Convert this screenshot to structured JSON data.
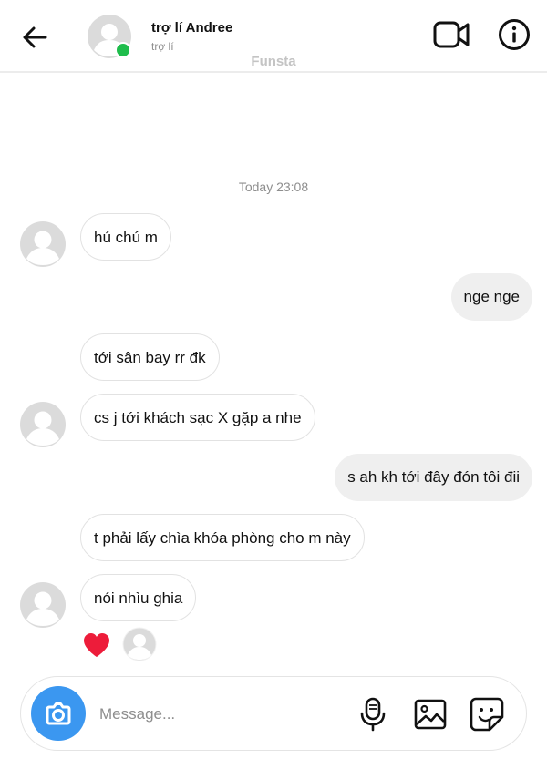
{
  "header": {
    "contact_name": "trợ lí Andree",
    "contact_subtitle": "trợ lí",
    "watermark": "Funsta"
  },
  "conversation": {
    "timestamp": "Today 23:08",
    "messages": [
      {
        "direction": "incoming",
        "text": "hú chú m"
      },
      {
        "direction": "outgoing",
        "text": "nge nge"
      },
      {
        "direction": "incoming",
        "text": "tới sân bay rr đk"
      },
      {
        "direction": "incoming",
        "text": "cs j tới khách sạc X gặp a nhe"
      },
      {
        "direction": "outgoing",
        "text": "s ah kh tới đây đón tôi đii"
      },
      {
        "direction": "incoming",
        "text": "t phải lấy chìa khóa phòng cho m này"
      },
      {
        "direction": "incoming",
        "text": "nói nhìu ghia"
      }
    ],
    "reaction": "heart"
  },
  "composer": {
    "placeholder": "Message..."
  },
  "icons": {
    "back": "arrow-left-icon",
    "video": "video-camera-icon",
    "info": "info-icon",
    "camera": "camera-icon",
    "mic": "microphone-icon",
    "gallery": "image-icon",
    "sticker": "sticker-icon"
  },
  "colors": {
    "accent": "#3b97f0",
    "online": "#1fbd4c",
    "heart": "#ed1c3a",
    "outgoing_bubble": "#efefef"
  }
}
